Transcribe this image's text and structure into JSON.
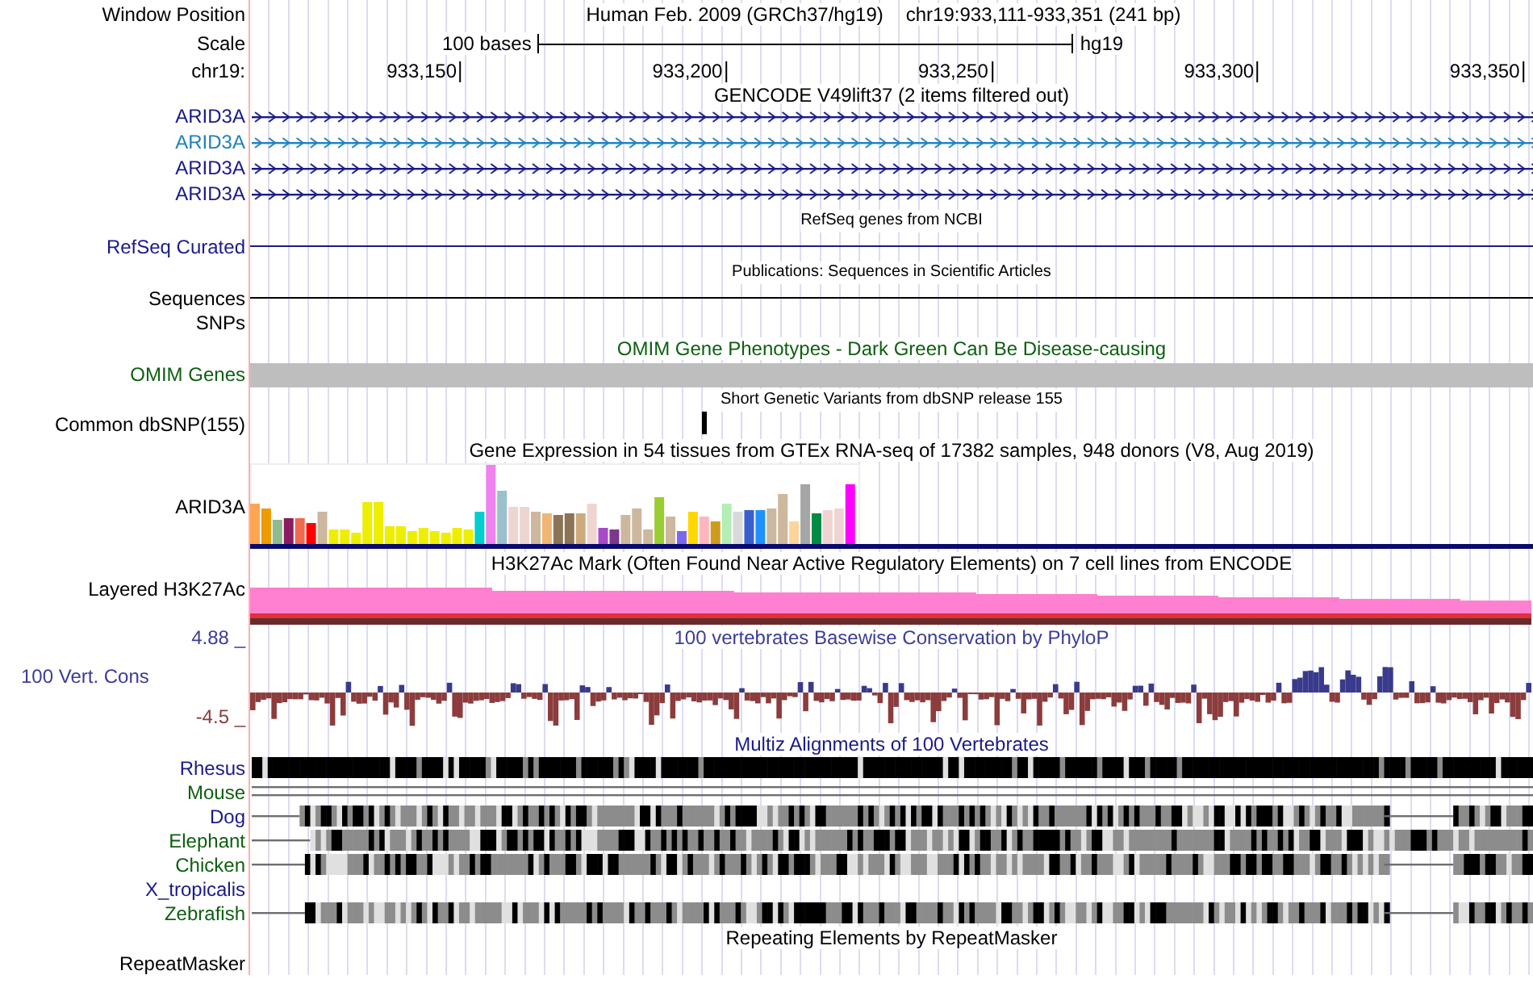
{
  "header": {
    "position_label": "Window Position",
    "assembly": "Human Feb. 2009 (GRCh37/hg19)",
    "position": "chr19:933,111-933,351 (241 bp)",
    "scale_label": "Scale",
    "scale_text": "100 bases",
    "scale_db": "hg19",
    "chrom_label": "chr19:",
    "ticks": [
      "933,150",
      "933,200",
      "933,250",
      "933,300",
      "933,350"
    ]
  },
  "tracks": [
    {
      "kind": "genes",
      "title": "GENCODE V49lift37 (2 items filtered out)",
      "items": [
        {
          "name": "ARID3A",
          "color": "#1a1a8a"
        },
        {
          "name": "ARID3A",
          "color": "#1f80c0"
        },
        {
          "name": "ARID3A",
          "color": "#1a1a8a"
        },
        {
          "name": "ARID3A",
          "color": "#1a1a8a"
        }
      ]
    },
    {
      "kind": "line",
      "title": "RefSeq genes from NCBI",
      "label": "RefSeq Curated",
      "color": "#1a1a8a"
    },
    {
      "kind": "line",
      "title": "Publications: Sequences in Scientific Articles",
      "label": "Sequences",
      "color": "#000000"
    },
    {
      "kind": "empty",
      "label": "SNPs",
      "color": "#000000"
    },
    {
      "kind": "bar",
      "title": "OMIM Gene Phenotypes - Dark Green Can Be Disease-causing",
      "label": "OMIM Genes",
      "color": "#0e6010"
    },
    {
      "kind": "snp",
      "title": "Short Genetic Variants from dbSNP release 155",
      "label": "Common dbSNP(155)",
      "color": "#000000"
    },
    {
      "kind": "expression",
      "title": "Gene Expression in 54 tissues from GTEx RNA-seq of 17382 samples, 948 donors (V8, Aug 2019)",
      "label": "ARID3A",
      "color": "#000000"
    },
    {
      "kind": "layered",
      "title": "H3K27Ac Mark (Often Found Near Active Regulatory Elements) on 7 cell lines from ENCODE",
      "label": "Layered H3K27Ac",
      "color": "#000000"
    },
    {
      "kind": "wiggle",
      "title": "100 vertebrates Basewise Conservation by PhyloP",
      "label": "100 Vert. Cons",
      "max": "4.88 _",
      "min": "-4.5 _",
      "color": "#3c3c98"
    },
    {
      "kind": "multiz",
      "title": "Multiz Alignments of 100 Vertebrates",
      "color": "#1a1a8a",
      "species": [
        {
          "name": "Rhesus",
          "color": "#1a1a8a",
          "kind": "full"
        },
        {
          "name": "Mouse",
          "color": "#0e6010",
          "kind": "lines"
        },
        {
          "name": "Dog",
          "color": "#1a1a8a",
          "kind": "partial"
        },
        {
          "name": "Elephant",
          "color": "#0e6010",
          "kind": "partial"
        },
        {
          "name": "Chicken",
          "color": "#0e6010",
          "kind": "partial"
        },
        {
          "name": "X_tropicalis",
          "color": "#1a1a8a",
          "kind": "none"
        },
        {
          "name": "Zebrafish",
          "color": "#0e6010",
          "kind": "partial"
        }
      ]
    },
    {
      "kind": "empty-titled",
      "title": "Repeating Elements by RepeatMasker",
      "label": "RepeatMasker",
      "color": "#000000"
    }
  ]
}
